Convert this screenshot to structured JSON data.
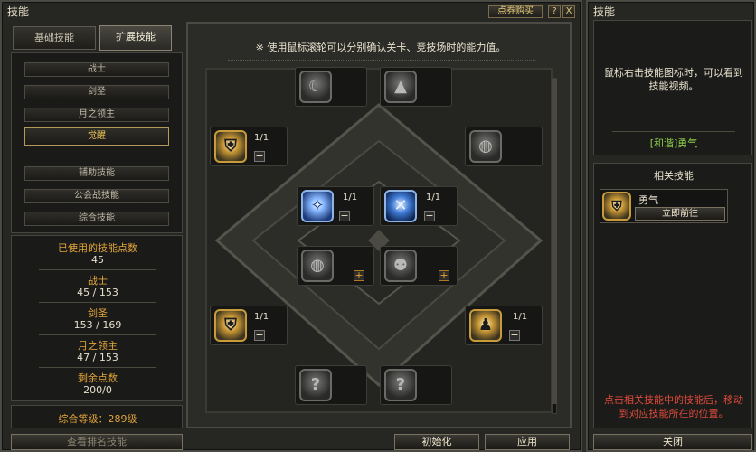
{
  "main_window": {
    "title": "技能",
    "shop_button": "点券购买",
    "help_button": "?",
    "close_button": "X"
  },
  "tabs": [
    "基础技能",
    "扩展技能"
  ],
  "categories_top": [
    "战士",
    "剑圣",
    "月之领主",
    "觉醒"
  ],
  "categories_bottom": [
    "辅助技能",
    "公会战技能",
    "综合技能"
  ],
  "stats": [
    {
      "label": "已使用的技能点数",
      "value": "45"
    },
    {
      "label": "战士",
      "value": "45 / 153"
    },
    {
      "label": "剑圣",
      "value": "153 / 169"
    },
    {
      "label": "月之领主",
      "value": "47 / 153"
    },
    {
      "label": "剩余点数",
      "value": "200/0"
    }
  ],
  "overall_level": "综合等级：289级",
  "ranking_button": "查看排名技能",
  "board": {
    "notice": "※ 使用鼠标滚轮可以分别确认关卡、竞技场时的能力值。",
    "levels": {
      "a": "1/1",
      "b": "1/1",
      "c": "1/1",
      "d": "1/1",
      "e": "1/1",
      "f": "1/1"
    },
    "minus": "−",
    "plus": "+"
  },
  "actions": {
    "init": "初始化",
    "apply": "应用"
  },
  "side": {
    "title": "技能",
    "hint": "鼠标右击技能图标时，可以看到技能视频。",
    "selected_skill": "[和谐]勇气",
    "related_title": "相关技能",
    "related_skill_name": "勇气",
    "goto_button": "立即前往",
    "footer_hint": "点击相关技能中的技能后，移动到对应技能所在的位置。",
    "close_button": "关闭"
  },
  "colors": {
    "accent_gold": "#e2a43a",
    "hint_green": "#8fcf4a",
    "hint_red": "#e04a3a"
  }
}
